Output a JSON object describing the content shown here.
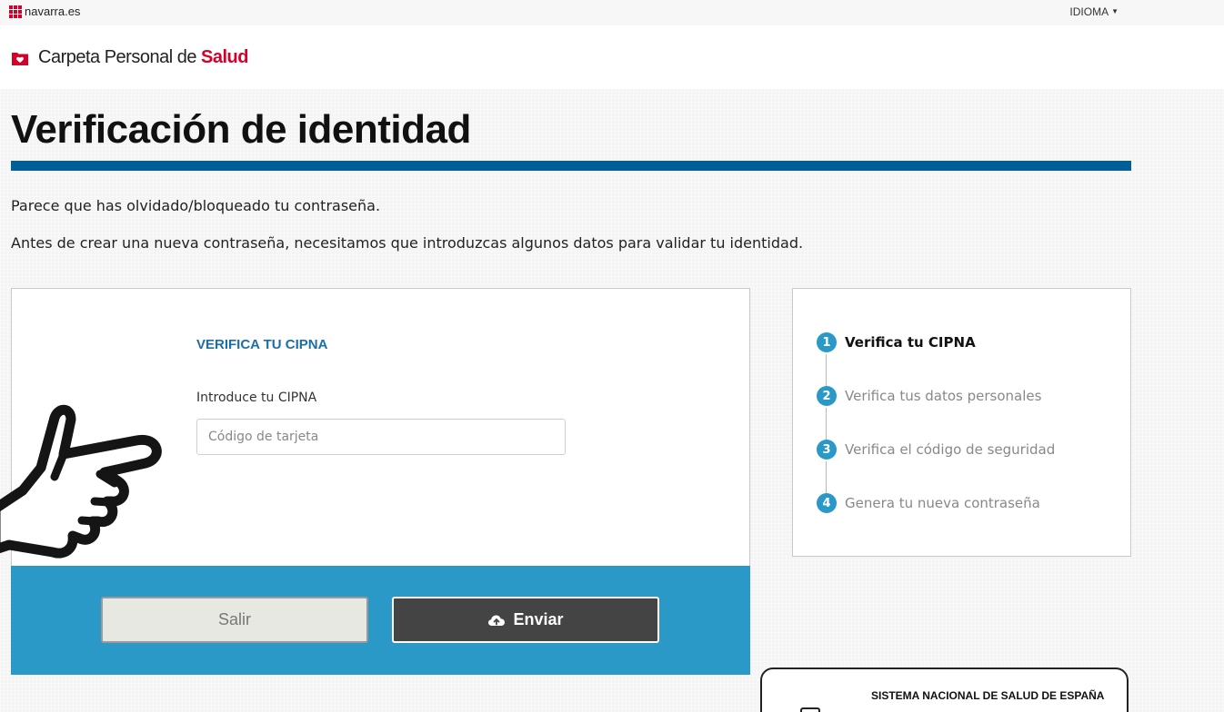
{
  "topbar": {
    "site_name": "navarra.es",
    "language_label": "IDIOMA"
  },
  "brand": {
    "name_prefix": "Carpeta Personal de ",
    "name_accent": "Salud"
  },
  "page": {
    "title": "Verificación de identidad",
    "intro_line_1": "Parece que has olvidado/bloqueado tu contraseña.",
    "intro_line_2": "Antes de crear una nueva contraseña, necesitamos que introduzcas algunos datos para validar tu identidad."
  },
  "form": {
    "heading": "VERIFICA TU CIPNA",
    "field_label": "Introduce tu CIPNA",
    "field_placeholder": "Código de tarjeta",
    "field_value": "",
    "cancel_label": "Salir",
    "submit_label": "Enviar"
  },
  "steps": [
    {
      "number": "1",
      "label": "Verifica tu CIPNA",
      "active": true
    },
    {
      "number": "2",
      "label": "Verifica tus datos personales",
      "active": false
    },
    {
      "number": "3",
      "label": "Verifica el código de seguridad",
      "active": false
    },
    {
      "number": "4",
      "label": "Genera tu nueva contraseña",
      "active": false
    }
  ],
  "sns_card": {
    "title": "SISTEMA NACIONAL DE SALUD DE ESPAÑA"
  },
  "colors": {
    "brand_red": "#d4002a",
    "primary_blue": "#005f99",
    "accent_cyan": "#2a99c7",
    "submit_dark": "#444444"
  },
  "icons": {
    "gov_logo": "navarra-dots-icon",
    "brand_logo": "heart-folder-icon",
    "language_caret": "caret-down-icon",
    "submit": "cloud-upload-icon",
    "overlay": "pointing-hand-icon"
  }
}
